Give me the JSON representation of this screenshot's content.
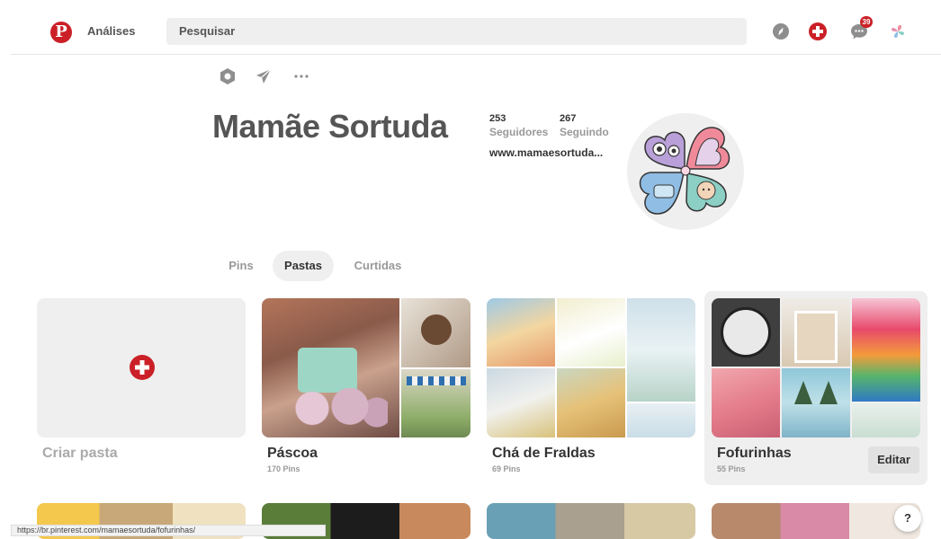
{
  "header": {
    "nav_analytics": "Análises",
    "search_placeholder": "Pesquisar",
    "notification_count": "39",
    "icons": [
      "pinterest-logo-icon",
      "compass-icon",
      "add-pin-icon",
      "messages-icon",
      "profile-avatar-icon"
    ]
  },
  "profile": {
    "name": "Mamãe Sortuda",
    "followers_count": "253",
    "followers_label": "Seguidores",
    "following_count": "267",
    "following_label": "Seguindo",
    "website": "www.mamaesortuda...",
    "action_icons": [
      "settings-hexagon-icon",
      "share-send-icon",
      "more-options-icon"
    ]
  },
  "tabs": [
    {
      "label": "Pins",
      "active": false
    },
    {
      "label": "Pastas",
      "active": true
    },
    {
      "label": "Curtidas",
      "active": false
    }
  ],
  "boards": [
    {
      "title": "Criar pasta",
      "count": "",
      "type": "create"
    },
    {
      "title": "Páscoa",
      "count": "170 Pins"
    },
    {
      "title": "Chá de Fraldas",
      "count": "69 Pins"
    },
    {
      "title": "Fofurinhas",
      "count": "55 Pins",
      "edit_label": "Editar"
    }
  ],
  "status_url": "https://br.pinterest.com/mamaesortuda/fofurinhas/",
  "help_label": "?",
  "colors": {
    "brand_red": "#cb2027",
    "text_dark": "#333333",
    "text_muted": "#999999",
    "search_bg": "#efefef"
  }
}
